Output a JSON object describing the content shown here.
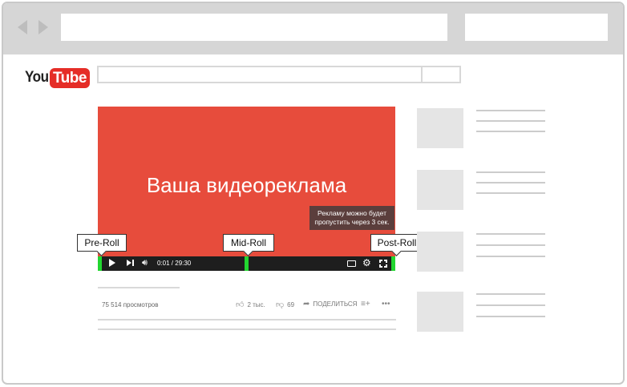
{
  "brand": {
    "you": "You",
    "tube": "Tube"
  },
  "video": {
    "title": "Ваша видеореклама",
    "skip_message": "Рекламу можно будет пропустить через 3 сек.",
    "time": "0:01 / 29:30"
  },
  "ad_markers": {
    "pre": "Pre-Roll",
    "mid": "Mid-Roll",
    "post": "Post-Roll"
  },
  "meta": {
    "views": "75 514 просмотров",
    "likes": "2 тыс.",
    "dislikes": "69",
    "share": "ПОДЕЛИТЬСЯ",
    "more": "•••"
  },
  "colors": {
    "video_bg": "#e74c3c",
    "marker": "#22d630",
    "logo_red": "#e52d27"
  },
  "icons": {
    "play": "play-icon",
    "next": "next-icon",
    "volume": "volume-icon",
    "settings": "gear-icon",
    "fullscreen": "fullscreen-icon",
    "like": "thumbs-up-icon",
    "dislike": "thumbs-down-icon",
    "share": "share-arrow-icon",
    "add": "add-to-playlist-icon"
  }
}
